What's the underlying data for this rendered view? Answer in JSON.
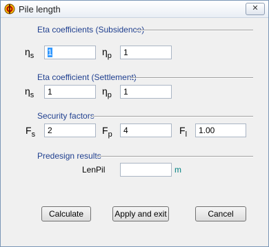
{
  "window": {
    "title": "Pile length",
    "close_label": "✕"
  },
  "sections": {
    "subsidence": "Eta coefficients (Subsidence)",
    "settlement": "Eta coefficient (Settlement)",
    "security": "Security factors",
    "predesign": "Predesign results"
  },
  "symbols": {
    "eta": "η",
    "s": "s",
    "p": "p",
    "F": "F",
    "l": "l"
  },
  "subsidence": {
    "eta_s": "1",
    "eta_p": "1"
  },
  "settlement": {
    "eta_s": "1",
    "eta_p": "1"
  },
  "security": {
    "Fs": "2",
    "Fp": "4",
    "Fl": "1.00"
  },
  "predesign": {
    "label": "LenPil",
    "value": "",
    "unit": "m"
  },
  "buttons": {
    "calculate": "Calculate",
    "apply_exit": "Apply and exit",
    "cancel": "Cancel"
  }
}
